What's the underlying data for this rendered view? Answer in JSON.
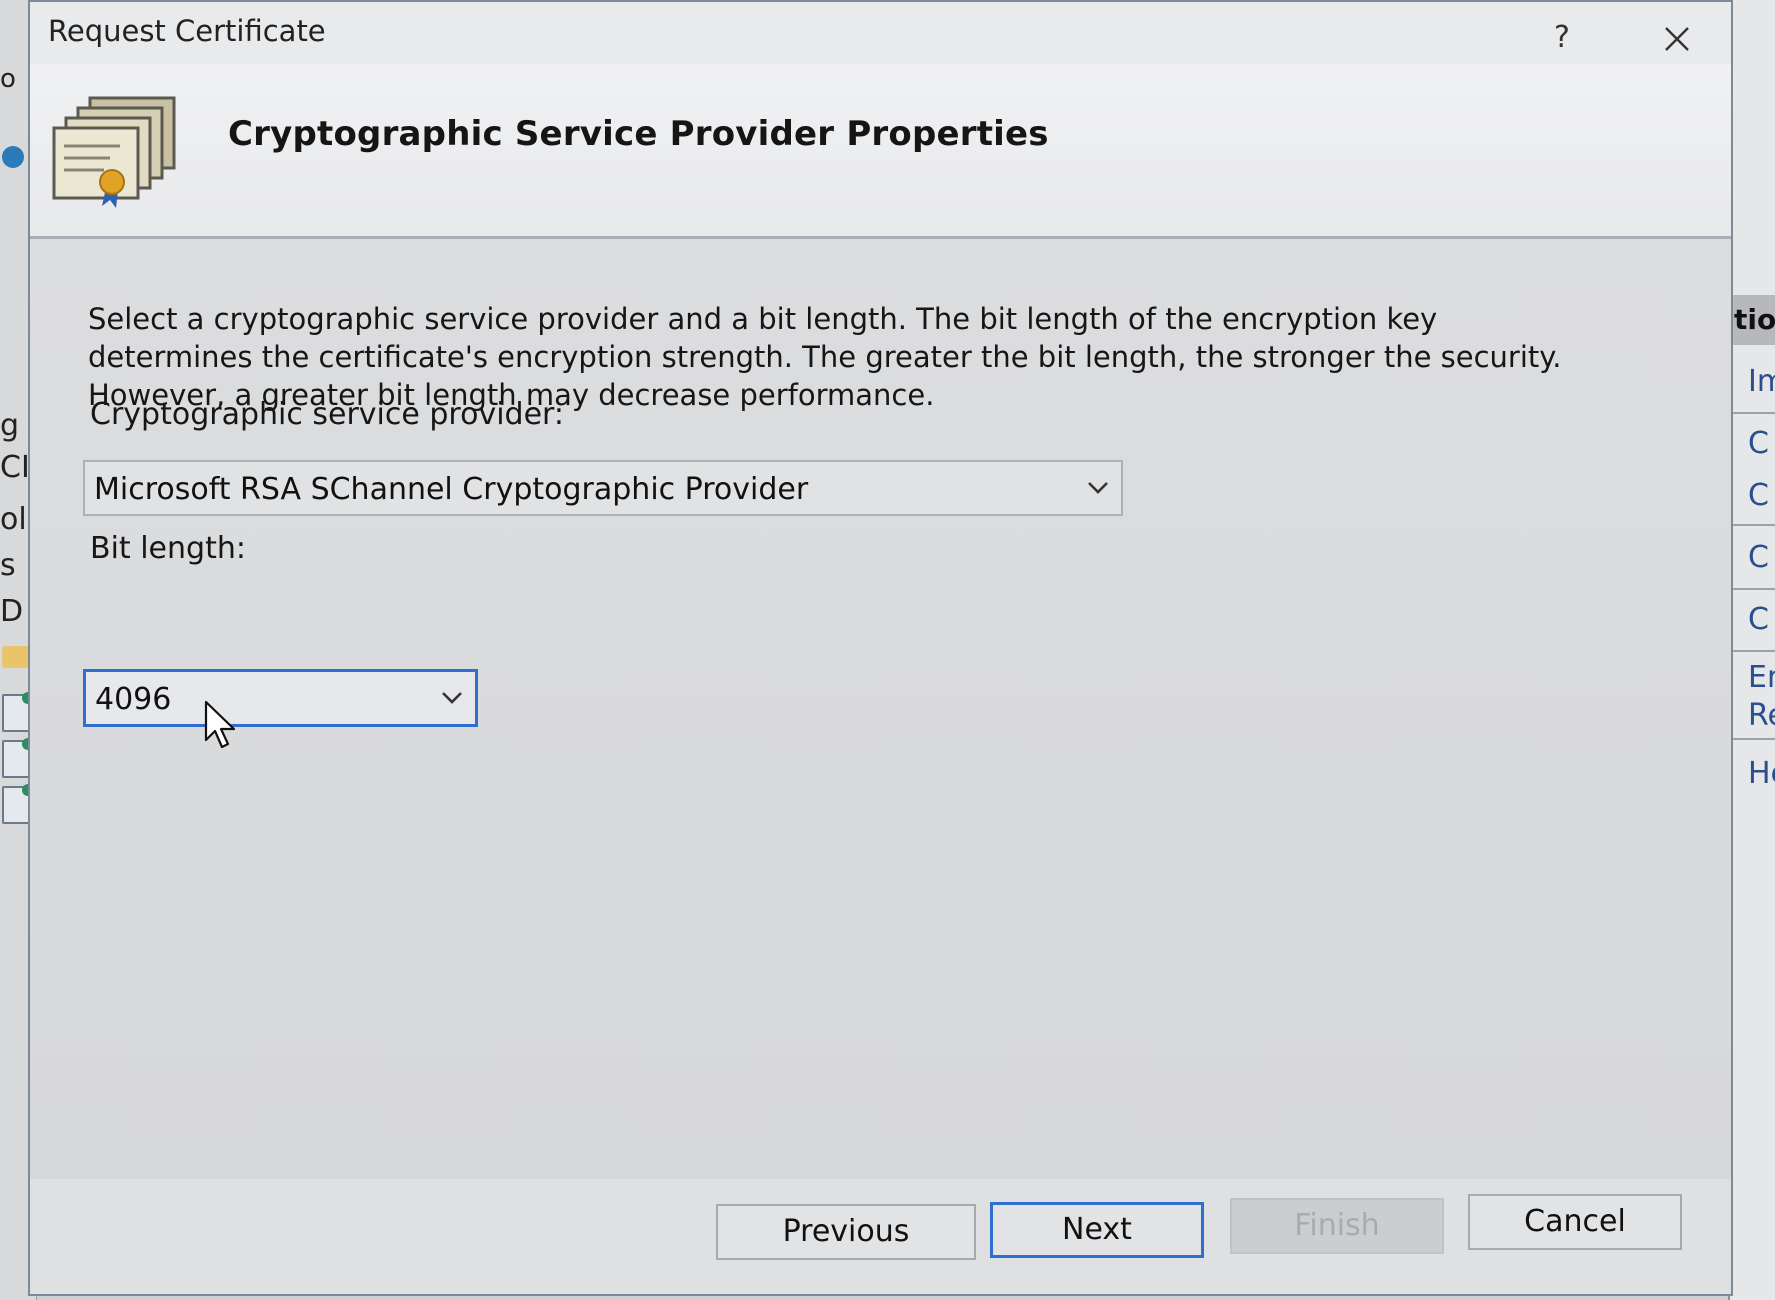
{
  "window": {
    "title": "Request Certificate",
    "help_label": "?",
    "close_icon": "close-icon"
  },
  "page": {
    "title": "Cryptographic Service Provider Properties",
    "description": "Select a cryptographic service provider and a bit length. The bit length of the encryption key determines the certificate's encryption strength. The greater the bit length, the stronger the security. However, a greater bit length may decrease performance."
  },
  "form": {
    "provider_label": "Cryptographic service provider:",
    "provider_value": "Microsoft RSA SChannel Cryptographic Provider",
    "bit_length_label": "Bit length:",
    "bit_length_value": "4096"
  },
  "buttons": {
    "previous": "Previous",
    "next": "Next",
    "finish": "Finish",
    "cancel": "Cancel"
  },
  "background_left": [
    "o",
    "g",
    "CI",
    "oli",
    "s",
    "D"
  ],
  "background_right": {
    "header": "tior",
    "items": [
      "Im",
      "C",
      "C",
      "C",
      "C",
      "En",
      "Re",
      "He"
    ]
  },
  "colors": {
    "focus_blue": "#2f6fd0",
    "dialog_bg": "#e9eaec",
    "disabled_text": "#a9abb0"
  }
}
